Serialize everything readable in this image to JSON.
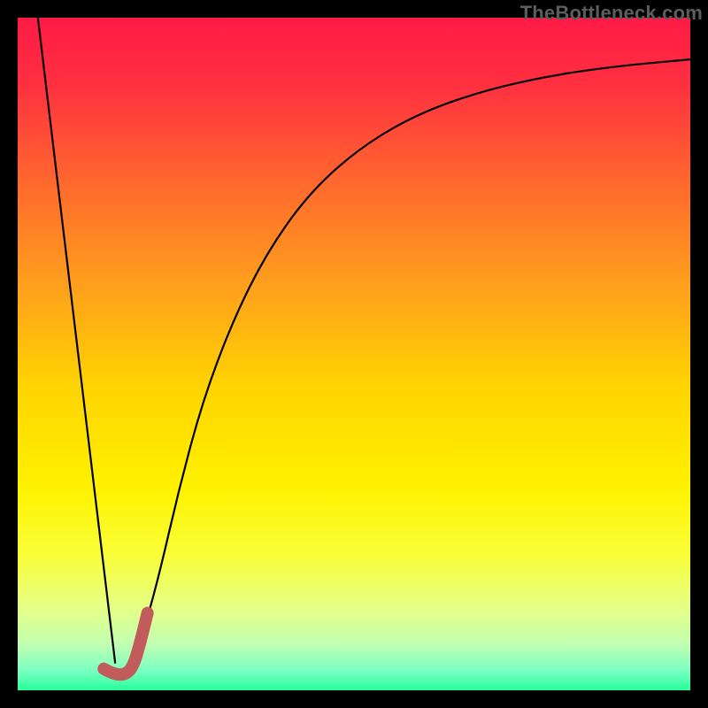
{
  "watermark": {
    "text": "TheBottleneck.com"
  },
  "chart_data": {
    "type": "line",
    "title": "",
    "xlabel": "",
    "ylabel": "",
    "xlim": [
      0,
      100
    ],
    "ylim": [
      0,
      100
    ],
    "grid": false,
    "legend": "none",
    "gradient_stops": [
      {
        "offset": 0.0,
        "color": "#ff1a45"
      },
      {
        "offset": 0.1,
        "color": "#ff3040"
      },
      {
        "offset": 0.25,
        "color": "#ff6a2d"
      },
      {
        "offset": 0.4,
        "color": "#ffa01c"
      },
      {
        "offset": 0.55,
        "color": "#ffd400"
      },
      {
        "offset": 0.7,
        "color": "#fff200"
      },
      {
        "offset": 0.8,
        "color": "#f9ff3a"
      },
      {
        "offset": 0.88,
        "color": "#e4ff88"
      },
      {
        "offset": 0.93,
        "color": "#c3ffb0"
      },
      {
        "offset": 0.97,
        "color": "#7dffc2"
      },
      {
        "offset": 1.0,
        "color": "#26ff9c"
      }
    ],
    "series": [
      {
        "name": "left-edge-line",
        "stroke": "#000000",
        "stroke_width": 2.2,
        "points": [
          {
            "x": 3.0,
            "y": 100.0
          },
          {
            "x": 14.5,
            "y": 4.0
          }
        ]
      },
      {
        "name": "rising-curve",
        "stroke": "#000000",
        "stroke_width": 2.2,
        "points": [
          {
            "x": 16.0,
            "y": 3.0
          },
          {
            "x": 18.5,
            "y": 8.0
          },
          {
            "x": 21.0,
            "y": 17.0
          },
          {
            "x": 24.0,
            "y": 30.0
          },
          {
            "x": 27.5,
            "y": 43.0
          },
          {
            "x": 32.0,
            "y": 55.0
          },
          {
            "x": 37.0,
            "y": 65.0
          },
          {
            "x": 43.0,
            "y": 73.5
          },
          {
            "x": 50.0,
            "y": 80.0
          },
          {
            "x": 58.0,
            "y": 85.0
          },
          {
            "x": 67.0,
            "y": 88.5
          },
          {
            "x": 77.0,
            "y": 91.0
          },
          {
            "x": 88.0,
            "y": 92.7
          },
          {
            "x": 100.0,
            "y": 93.8
          }
        ]
      },
      {
        "name": "j-marker",
        "stroke": "#c25b5b",
        "stroke_width": 14,
        "linecap": "round",
        "points": [
          {
            "x": 12.8,
            "y": 3.2
          },
          {
            "x": 14.2,
            "y": 2.4
          },
          {
            "x": 16.0,
            "y": 2.3
          },
          {
            "x": 17.2,
            "y": 3.6
          },
          {
            "x": 18.2,
            "y": 7.0
          },
          {
            "x": 19.3,
            "y": 11.5
          }
        ]
      }
    ]
  }
}
